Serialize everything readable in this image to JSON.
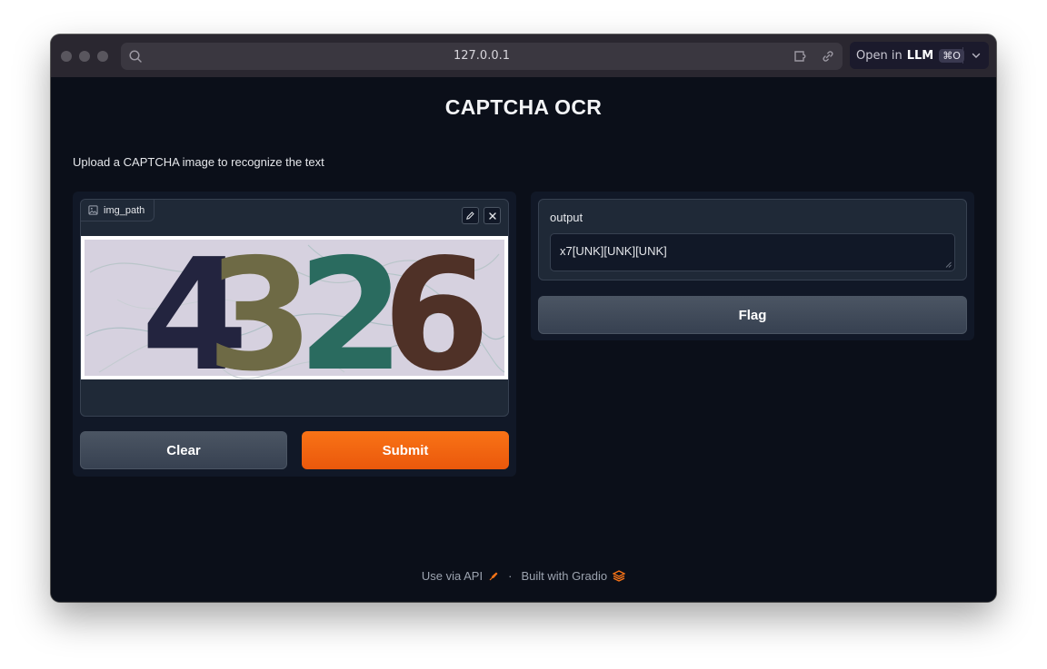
{
  "browser": {
    "url": "127.0.0.1",
    "open_in_label": "Open in",
    "open_in_app": "LLM",
    "shortcut": "⌘O"
  },
  "app": {
    "title": "CAPTCHA OCR",
    "description": "Upload a CAPTCHA image to recognize the text"
  },
  "input": {
    "label": "img_path",
    "captcha_chars": [
      {
        "char": "4",
        "color": "#23243f"
      },
      {
        "char": "3",
        "color": "#6e6a45"
      },
      {
        "char": "2",
        "color": "#2a6b5f"
      },
      {
        "char": "6",
        "color": "#4f3127"
      }
    ],
    "clear_label": "Clear",
    "submit_label": "Submit"
  },
  "output": {
    "label": "output",
    "value": "x7[UNK][UNK][UNK]",
    "flag_label": "Flag"
  },
  "footer": {
    "api_label": "Use via API",
    "separator": "·",
    "built_label": "Built with Gradio"
  },
  "colors": {
    "accent": "#f97316",
    "background": "#0b0f19"
  }
}
